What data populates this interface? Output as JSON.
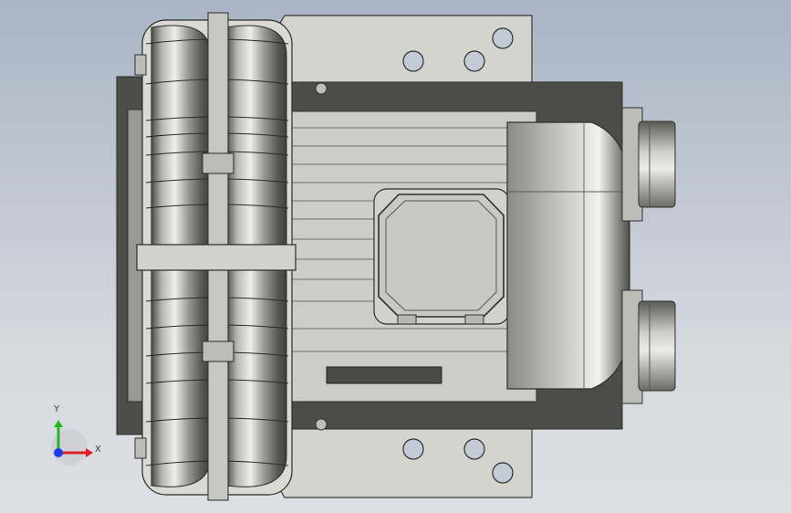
{
  "viewport": {
    "background_top": "#a9b4c4",
    "background_bottom": "#dcdfe3"
  },
  "model": {
    "body_color": "#c9c9c3",
    "shadow_color": "#4a4a48",
    "metal_color": "#d2d2cc"
  },
  "triad": {
    "x_label": "X",
    "y_label": "Y",
    "x_color": "#e02020",
    "y_color": "#22b822",
    "z_color": "#1a3cf0"
  }
}
